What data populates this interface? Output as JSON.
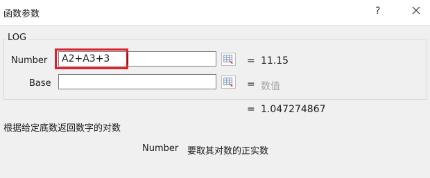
{
  "window": {
    "title": "函数参数",
    "help_label": "?"
  },
  "function": {
    "name": "LOG"
  },
  "args": [
    {
      "label": "Number",
      "value": "A2+A3+3",
      "result": "11.15"
    },
    {
      "label": "Base",
      "value": "",
      "placeholder": "数值"
    }
  ],
  "equals_sign": "=",
  "formula_result": "1.047274867",
  "description": "根据给定底数返回数字的对数",
  "param_help": {
    "name": "Number",
    "text": "要取其对数的正实数"
  },
  "icons": {
    "close": "close-icon",
    "range_select": "range-select-icon"
  },
  "colors": {
    "highlight": "#e01e2b",
    "placeholder_text": "#a6a6a6"
  }
}
